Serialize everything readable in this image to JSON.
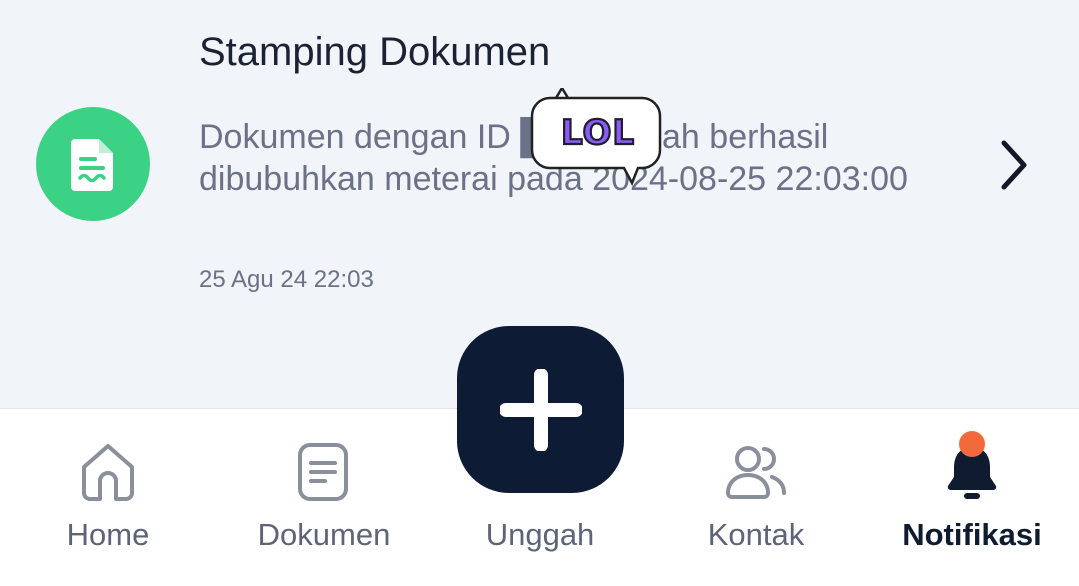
{
  "notification": {
    "title": "Stamping Dokumen",
    "body": "Dokumen dengan ID ████ telah berhasil dibubuhkan meterai pada 2024-08-25 22:03:00",
    "time": "25 Agu 24 22:03",
    "icon": "document-icon",
    "icon_color": "#3cd285"
  },
  "sticker": {
    "text": "LOL"
  },
  "nav": {
    "items": [
      {
        "label": "Home",
        "icon": "home-icon"
      },
      {
        "label": "Dokumen",
        "icon": "document-list-icon"
      },
      {
        "label": "Unggah",
        "icon": "plus-icon"
      },
      {
        "label": "Kontak",
        "icon": "contacts-icon"
      },
      {
        "label": "Notifikasi",
        "icon": "bell-icon",
        "active": true
      }
    ],
    "active_color": "#0f1b2e",
    "badge_color": "#f26a3c"
  }
}
